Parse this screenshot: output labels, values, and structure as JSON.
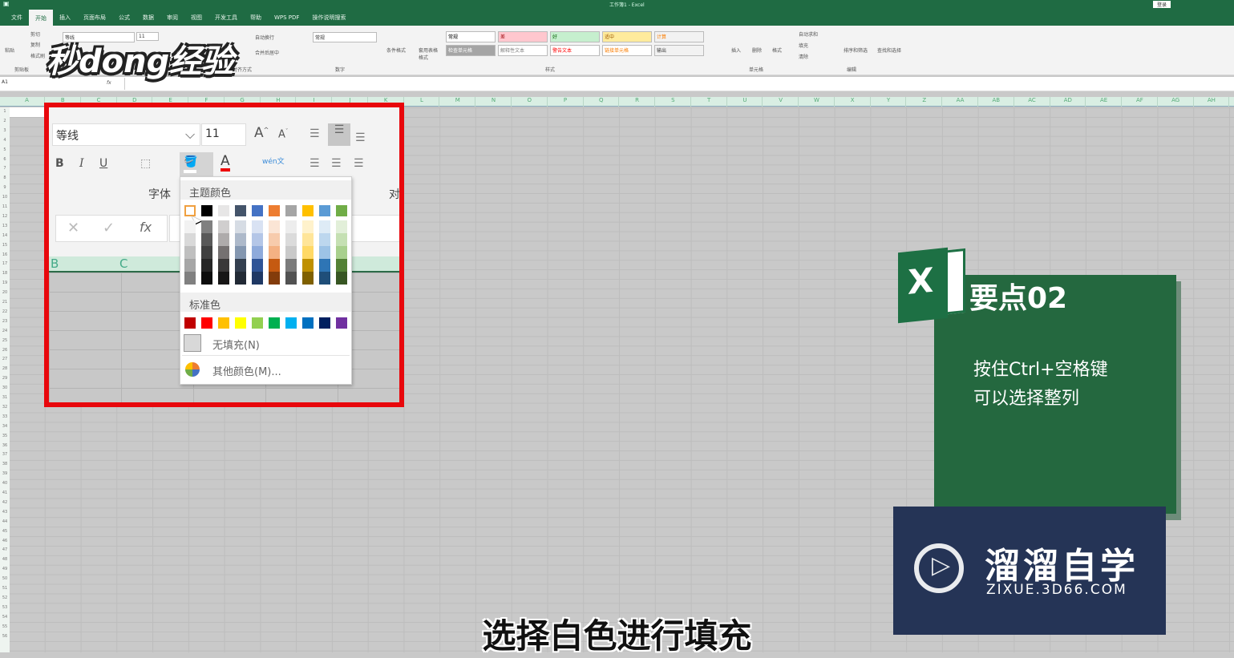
{
  "window": {
    "title": "工作簿1 - Excel",
    "login": "登录"
  },
  "tabs": [
    "文件",
    "开始",
    "插入",
    "页面布局",
    "公式",
    "数据",
    "审阅",
    "视图",
    "开发工具",
    "帮助",
    "WPS PDF",
    "操作说明搜索"
  ],
  "ribbon": {
    "clipboard": {
      "paste": "粘贴",
      "cut": "剪切",
      "copy": "复制",
      "format_painter": "格式刷",
      "group": "剪贴板"
    },
    "font": {
      "name": "等线",
      "size": "11",
      "group": "字体"
    },
    "align": {
      "wrap": "自动换行",
      "merge": "合并后居中",
      "group": "对齐方式"
    },
    "number": {
      "format": "常规",
      "group": "数字"
    },
    "styles": {
      "cond": "条件格式",
      "table": "套用表格格式",
      "cells": [
        "常规",
        "差",
        "好",
        "适中",
        "计算",
        "检查单元格",
        "解释性文本",
        "警告文本",
        "链接单元格",
        "输出"
      ],
      "group": "样式"
    },
    "cells": {
      "insert": "插入",
      "delete": "删除",
      "format": "格式",
      "group": "单元格"
    },
    "editing": {
      "autosum": "自动求和",
      "fill": "填充",
      "clear": "清除",
      "sort": "排序和筛选",
      "find": "查找和选择",
      "group": "编辑"
    }
  },
  "formula_bar": {
    "name_box": "A1",
    "fx": "fx"
  },
  "columns": [
    "A",
    "B",
    "C",
    "D",
    "E",
    "F",
    "G",
    "H",
    "I",
    "J",
    "K",
    "L",
    "M",
    "N",
    "O",
    "P",
    "Q",
    "R",
    "S",
    "T",
    "U",
    "V",
    "W",
    "X",
    "Y",
    "Z",
    "AA",
    "AB",
    "AC",
    "AD",
    "AE",
    "AF",
    "AG",
    "AH"
  ],
  "zoom_panel": {
    "font": "等线",
    "size": "11",
    "font_group": "字体",
    "align_group": "对",
    "col_b": "B",
    "col_c": "C"
  },
  "palette": {
    "theme_title": "主题颜色",
    "theme": [
      "#ffffff",
      "#000000",
      "#e7e6e6",
      "#44546a",
      "#4472c4",
      "#ed7d31",
      "#a5a5a5",
      "#ffc000",
      "#5b9bd5",
      "#70ad47"
    ],
    "shades": [
      [
        "#f2f2f2",
        "#d9d9d9",
        "#bfbfbf",
        "#a6a6a6",
        "#808080"
      ],
      [
        "#808080",
        "#595959",
        "#404040",
        "#262626",
        "#0d0d0d"
      ],
      [
        "#d0cece",
        "#aeabab",
        "#757171",
        "#3a3838",
        "#171616"
      ],
      [
        "#d6dce4",
        "#adb9ca",
        "#8497b0",
        "#333f4f",
        "#222a35"
      ],
      [
        "#d9e2f3",
        "#b4c6e7",
        "#8eaadb",
        "#2f5496",
        "#1f3864"
      ],
      [
        "#fbe5d5",
        "#f7cbac",
        "#f4b183",
        "#c55a11",
        "#833c0b"
      ],
      [
        "#ededed",
        "#dbdbdb",
        "#c9c9c9",
        "#7b7b7b",
        "#525252"
      ],
      [
        "#fff2cc",
        "#ffe599",
        "#ffd966",
        "#bf9000",
        "#7f6000"
      ],
      [
        "#deebf6",
        "#bdd7ee",
        "#9dc3e6",
        "#2e75b5",
        "#1f4e79"
      ],
      [
        "#e2efd9",
        "#c5e0b3",
        "#a8d08d",
        "#538135",
        "#375623"
      ]
    ],
    "standard_title": "标准色",
    "standard": [
      "#c00000",
      "#ff0000",
      "#ffc000",
      "#ffff00",
      "#92d050",
      "#00b050",
      "#00b0f0",
      "#0070c0",
      "#002060",
      "#7030a0"
    ],
    "no_fill": "无填充(N)",
    "more": "其他颜色(M)..."
  },
  "card": {
    "title": "要点02",
    "line1": "按住Ctrl+空格键",
    "line2": "可以选择整列"
  },
  "brand": {
    "name": "溜溜自学",
    "url": "ZIXUE.3D66.COM",
    "watermark": "秒dong经验"
  },
  "subtitle": "选择白色进行填充"
}
